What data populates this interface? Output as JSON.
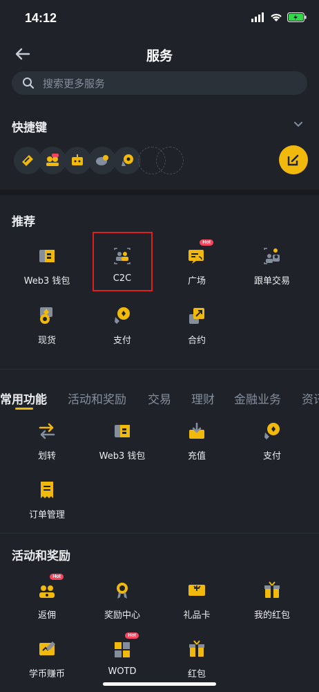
{
  "status_bar": {
    "time": "14:12"
  },
  "header": {
    "title": "服务"
  },
  "search": {
    "placeholder": "搜索更多服务"
  },
  "shortcuts": {
    "title": "快捷键",
    "icons": [
      "shortcut-1-icon",
      "shortcut-2-icon",
      "shortcut-3-icon",
      "shortcut-4-icon",
      "shortcut-5-icon"
    ]
  },
  "recommended": {
    "title": "推荐",
    "items": [
      {
        "label": "Web3 钱包"
      },
      {
        "label": "C2C"
      },
      {
        "label": "广场",
        "badge": "Hot"
      },
      {
        "label": "跟单交易"
      },
      {
        "label": "现货"
      },
      {
        "label": "支付"
      },
      {
        "label": "合约"
      }
    ]
  },
  "tabs": [
    "常用功能",
    "活动和奖励",
    "交易",
    "理财",
    "金融业务",
    "资讯"
  ],
  "common": {
    "items": [
      {
        "label": "划转"
      },
      {
        "label": "Web3 钱包"
      },
      {
        "label": "充值"
      },
      {
        "label": "支付"
      },
      {
        "label": "订单管理"
      }
    ]
  },
  "rewards": {
    "title": "活动和奖励",
    "items": [
      {
        "label": "返佣",
        "badge": "Hot"
      },
      {
        "label": "奖励中心"
      },
      {
        "label": "礼品卡"
      },
      {
        "label": "我的红包"
      },
      {
        "label": "学币赚币"
      },
      {
        "label": "WOTD",
        "badge": "Hot"
      },
      {
        "label": "红包"
      }
    ]
  },
  "colors": {
    "accent": "#F0B90B",
    "background": "#1F2329",
    "hot": "#F6465D"
  }
}
